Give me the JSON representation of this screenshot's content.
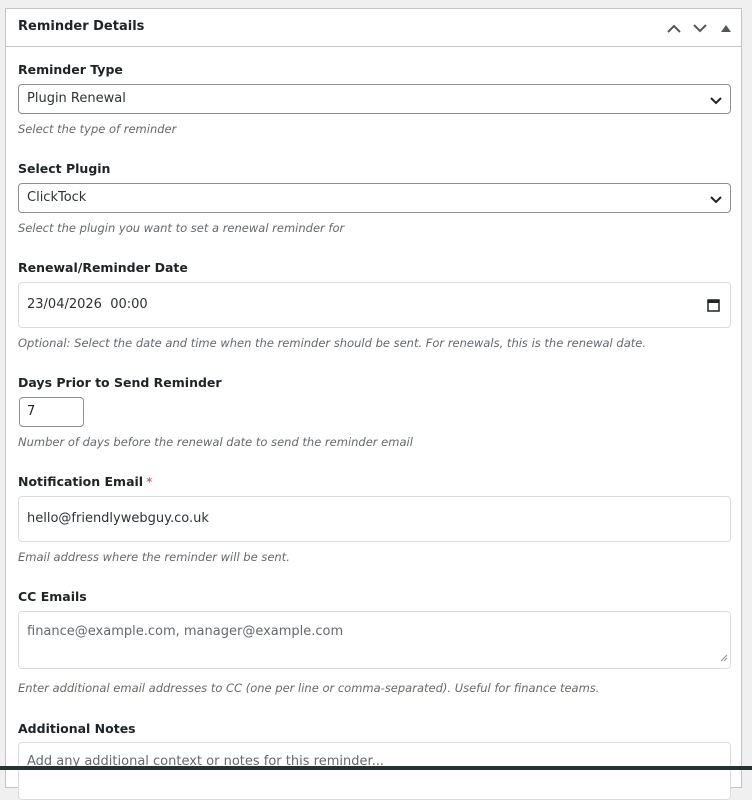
{
  "panel": {
    "title": "Reminder Details",
    "icons": [
      "chevron-up-icon",
      "chevron-down-icon",
      "triangle-up-icon"
    ]
  },
  "fields": {
    "reminder_type": {
      "label": "Reminder Type",
      "value": "Plugin Renewal",
      "description": "Select the type of reminder"
    },
    "select_plugin": {
      "label": "Select Plugin",
      "value": "ClickTock",
      "description": "Select the plugin you want to set a renewal reminder for"
    },
    "reminder_date": {
      "label": "Renewal/Reminder Date",
      "value": "23/04/2026  00:00",
      "description": "Optional: Select the date and time when the reminder should be sent. For renewals, this is the renewal date."
    },
    "days_prior": {
      "label": "Days Prior to Send Reminder",
      "value": "7",
      "description": "Number of days before the renewal date to send the reminder email"
    },
    "notification_email": {
      "label": "Notification Email",
      "required_mark": "*",
      "value": "hello@friendlywebguy.co.uk",
      "description": "Email address where the reminder will be sent."
    },
    "cc_emails": {
      "label": "CC Emails",
      "placeholder": "finance@example.com, manager@example.com",
      "description": "Enter additional email addresses to CC (one per line or comma-separated). Useful for finance teams."
    },
    "additional_notes": {
      "label": "Additional Notes",
      "placeholder": "Add any additional context or notes for this reminder..."
    }
  },
  "colors": {
    "border": "#c3c4c7",
    "text": "#1d2327",
    "description": "#646970",
    "required": "#d63638"
  }
}
